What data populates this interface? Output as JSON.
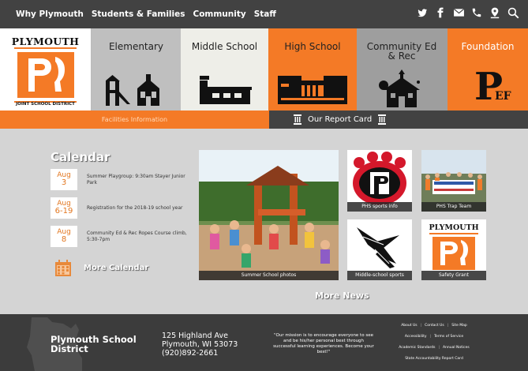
{
  "nav": {
    "items": [
      "Why Plymouth",
      "Students & Families",
      "Community",
      "Staff"
    ],
    "icons": [
      "twitter-icon",
      "facebook-icon",
      "mail-icon",
      "phone-icon",
      "location-icon",
      "search-icon"
    ]
  },
  "tiles": {
    "logo": {
      "top": "PLYMOUTH",
      "bottom": "JOINT SCHOOL DISTRICT"
    },
    "items": [
      "Elementary",
      "Middle School",
      "High School",
      "Community Ed & Rec",
      "Foundation"
    ],
    "foundation_mark": "EF"
  },
  "subbar": {
    "facilities": "Facilities Information",
    "report": "Our Report Card"
  },
  "calendar": {
    "title": "Calendar",
    "events": [
      {
        "month": "Aug",
        "day": "3",
        "text": "Summer Playgroup: 9:30am Stayer Junior Park"
      },
      {
        "month": "Aug",
        "day": "6-19",
        "text": "Registration for the 2018-19 school year"
      },
      {
        "month": "Aug",
        "day": "8",
        "text": "Community Ed & Rec Ropes Course climb, 5:30-7pm"
      }
    ],
    "more": "More Calendar"
  },
  "news": {
    "items": [
      "Summer School photos",
      "PHS sports info",
      "PHS Trap Team",
      "Middle-school sports",
      "Safety Grant"
    ],
    "safety_logo_text": "PLYMOUTH",
    "more": "More News"
  },
  "footer": {
    "name_line1": "Plymouth School",
    "name_line2": "District",
    "addr_line1": "125 Highland Ave",
    "addr_line2": "Plymouth, WI 53073",
    "addr_line3": "(920)892-2661",
    "mission": "\"Our mission is to encourage everyone to see and be his/her personal best through successful learning experiences. Become your best!\"",
    "links_row1": [
      "About Us",
      "Contact Us",
      "Site Map"
    ],
    "links_row2": [
      "Accessibility",
      "Terms of Service"
    ],
    "links_row3": [
      "Academic Standards",
      "Annual Notices"
    ],
    "links_row4": [
      "State Accountability Report Card"
    ]
  },
  "colors": {
    "orange": "#f47a26",
    "dark": "#424242",
    "page_bg": "#d4d4d4"
  }
}
